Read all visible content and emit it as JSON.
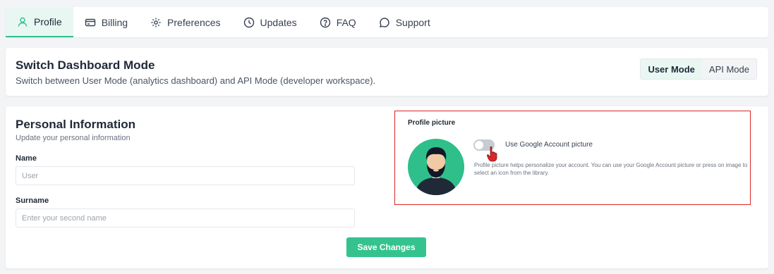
{
  "tabs": [
    {
      "label": "Profile",
      "icon": "user-icon",
      "active": true
    },
    {
      "label": "Billing",
      "icon": "credit-card-icon",
      "active": false
    },
    {
      "label": "Preferences",
      "icon": "gear-icon",
      "active": false
    },
    {
      "label": "Updates",
      "icon": "clock-icon",
      "active": false
    },
    {
      "label": "FAQ",
      "icon": "question-circle-icon",
      "active": false
    },
    {
      "label": "Support",
      "icon": "chat-bubble-icon",
      "active": false
    }
  ],
  "dashboard_mode": {
    "title": "Switch Dashboard Mode",
    "description": "Switch between User Mode (analytics dashboard) and API Mode (developer workspace).",
    "options": [
      "User Mode",
      "API Mode"
    ],
    "selected": "User Mode"
  },
  "personal_info": {
    "title": "Personal Information",
    "subtitle": "Update your personal information",
    "name_label": "Name",
    "name_placeholder": "User",
    "name_value": "",
    "surname_label": "Surname",
    "surname_placeholder": "Enter your second name",
    "surname_value": "",
    "save_label": "Save Changes"
  },
  "profile_picture": {
    "title": "Profile picture",
    "toggle_label": "Use Google Account picture",
    "toggle_on": false,
    "help_text": "Profile picture helps personalize your account. You can use your Google Account picture or press on image to select an icon from the library."
  },
  "colors": {
    "accent": "#34c38f",
    "active_tab_bg": "#e9f7f2",
    "highlight_border": "#dc2626"
  }
}
